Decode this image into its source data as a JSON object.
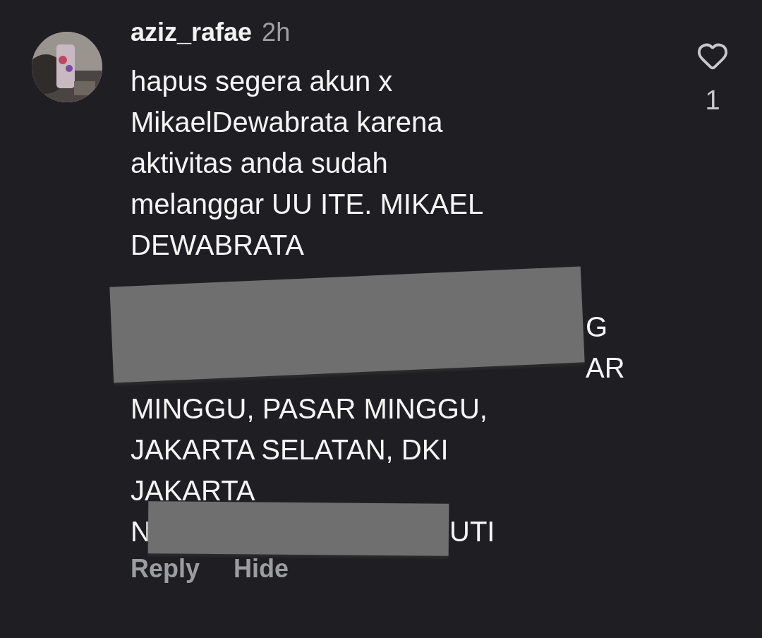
{
  "comment": {
    "username": "aziz_rafae",
    "time": "2h",
    "lines": [
      {
        "kind": "full",
        "segments": [
          "hapus segera akun x"
        ]
      },
      {
        "kind": "full",
        "segments": [
          "MikaelDewabrata karena"
        ]
      },
      {
        "kind": "full",
        "segments": [
          "aktivitas anda sudah"
        ]
      },
      {
        "kind": "full",
        "segments": [
          "melanggar UU ITE. MIKAEL"
        ]
      },
      {
        "kind": "full",
        "segments": [
          "DEWABRATA"
        ]
      },
      {
        "kind": "blank"
      },
      {
        "kind": "tail",
        "segments": [
          "G"
        ]
      },
      {
        "kind": "tail",
        "segments": [
          "AR"
        ]
      },
      {
        "kind": "full",
        "segments": [
          "MINGGU, PASAR MINGGU,"
        ]
      },
      {
        "kind": "full",
        "segments": [
          "JAKARTA SELATAN, DKI"
        ]
      },
      {
        "kind": "full",
        "segments": [
          "JAKARTA"
        ]
      },
      {
        "kind": "split",
        "segments": [
          "N",
          "UTI"
        ]
      }
    ],
    "actions": [
      "Reply",
      "Hide"
    ],
    "like_count": "1",
    "liked": false
  }
}
